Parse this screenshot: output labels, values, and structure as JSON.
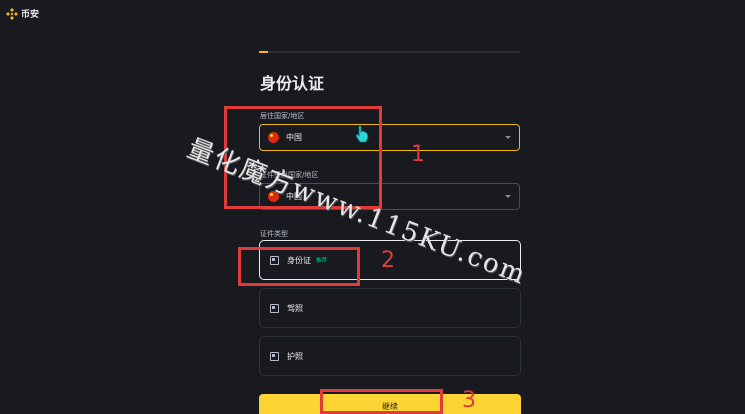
{
  "header": {
    "logo_text": "币安",
    "logo_icon": "binance-diamond-icon",
    "brand_color": "#f0b90b"
  },
  "progress": {
    "fraction": 0.035
  },
  "page": {
    "title": "身份认证"
  },
  "residence": {
    "label": "居住国家/地区",
    "value": "中国",
    "flag_icon": "china-flag-icon"
  },
  "issuing": {
    "label": "证件签发国家/地区",
    "value": "中国",
    "flag_icon": "china-flag-icon"
  },
  "doc_type": {
    "label": "证件类型",
    "options": [
      {
        "label": "身份证",
        "badge": "推荐",
        "icon": "id-card-icon"
      },
      {
        "label": "驾照",
        "icon": "driver-license-icon"
      },
      {
        "label": "护照",
        "icon": "passport-icon"
      }
    ]
  },
  "continue_button": {
    "label": "继续",
    "color": "#fcd535"
  },
  "annotations": {
    "box1_number": "1",
    "box2_number": "2",
    "box3_number": "3",
    "color": "#e03a3a"
  },
  "watermark": {
    "text": "量化魔方www.115KU.com"
  }
}
